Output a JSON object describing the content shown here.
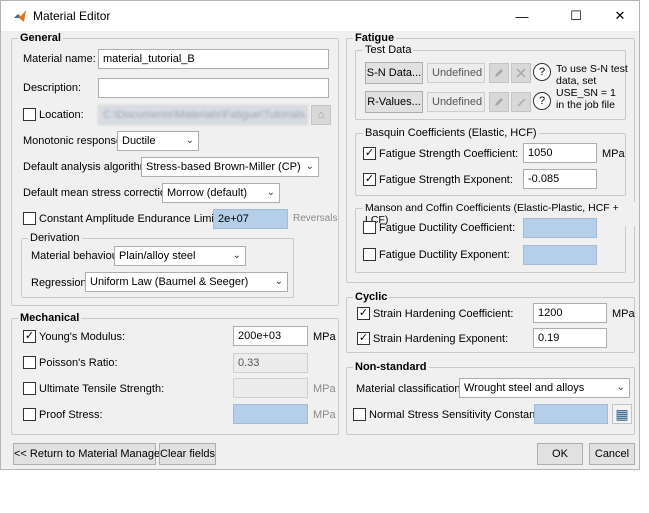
{
  "window": {
    "title": "Material Editor",
    "minimize": "—",
    "maximize": "☐",
    "close": "✕"
  },
  "general": {
    "title": "General",
    "material_name_label": "Material name:",
    "material_name_value": "material_tutorial_B",
    "description_label": "Description:",
    "description_value": "",
    "location_label": "Location:",
    "location_value": "C:\\Documents\\Materials\\Fatigue\\Tutorials",
    "monotonic_label": "Monotonic response:",
    "monotonic_value": "Ductile",
    "algorithm_label": "Default analysis algorithm:",
    "algorithm_value": "Stress-based Brown-Miller (CP)",
    "mean_stress_label": "Default mean stress correction:",
    "mean_stress_value": "Morrow (default)",
    "cael_label": "Constant Amplitude Endurance Limit:",
    "cael_value": "2e+07",
    "cael_unit": "Reversals",
    "derivation": {
      "title": "Derivation",
      "behaviour_label": "Material behaviour:",
      "behaviour_value": "Plain/alloy steel",
      "regression_label": "Regression:",
      "regression_value": "Uniform Law (Baumel & Seeger)"
    }
  },
  "mechanical": {
    "title": "Mechanical",
    "youngs_label": "Young's Modulus:",
    "youngs_value": "200e+03",
    "youngs_unit": "MPa",
    "poisson_label": "Poisson's Ratio:",
    "poisson_value": "0.33",
    "uts_label": "Ultimate Tensile Strength:",
    "uts_value": "",
    "uts_unit": "MPa",
    "proof_label": "Proof Stress:",
    "proof_value": "",
    "proof_unit": "MPa"
  },
  "fatigue": {
    "title": "Fatigue",
    "test_data": {
      "title": "Test Data",
      "sn_button": "S-N Data...",
      "sn_value": "Undefined",
      "rvalues_button": "R-Values...",
      "rvalues_value": "Undefined",
      "help": "?",
      "note_line1": "To use S-N test",
      "note_line2": "data, set",
      "note_line3": "USE_SN = 1",
      "note_line4": "in the job file"
    },
    "basquin": {
      "title": "Basquin Coefficients (Elastic, HCF)",
      "coef_label": "Fatigue Strength Coefficient:",
      "coef_value": "1050",
      "coef_unit": "MPa",
      "exp_label": "Fatigue Strength Exponent:",
      "exp_value": "-0.085"
    },
    "manson": {
      "title": "Manson and Coffin Coefficients (Elastic-Plastic, HCF + LCF)",
      "coef_label": "Fatigue Ductility Coefficient:",
      "exp_label": "Fatigue Ductility Exponent:"
    }
  },
  "cyclic": {
    "title": "Cyclic",
    "coef_label": "Strain Hardening Coefficient:",
    "coef_value": "1200",
    "coef_unit": "MPa",
    "exp_label": "Strain Hardening Exponent:",
    "exp_value": "0.19"
  },
  "nonstandard": {
    "title": "Non-standard",
    "classification_label": "Material classification:",
    "classification_value": "Wrought steel and alloys",
    "nssc_label": "Normal Stress Sensitivity Constant:"
  },
  "footer": {
    "return_button": "<< Return to Material Manager",
    "clear_button": "Clear fields",
    "ok_button": "OK",
    "cancel_button": "Cancel"
  },
  "marks": {
    "check": "✓",
    "chevron": "⌄",
    "folder": "⌂",
    "grid": "▦"
  }
}
